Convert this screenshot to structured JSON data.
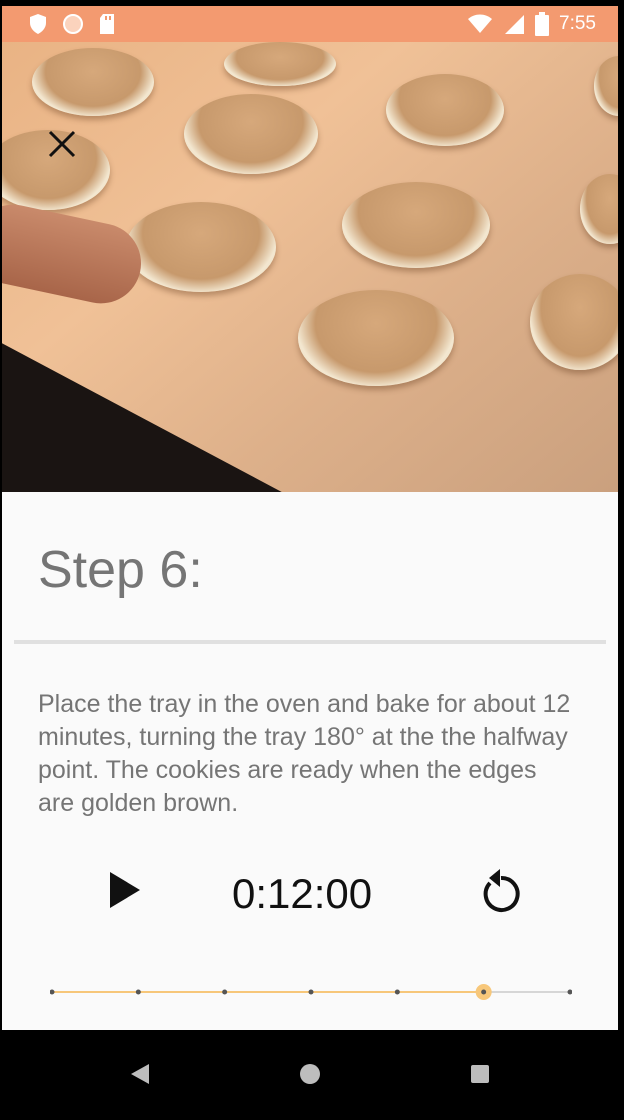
{
  "status_bar": {
    "time": "7:55",
    "icons": [
      "shield-icon",
      "circle-icon",
      "sd-card-icon",
      "wifi-icon",
      "signal-icon",
      "battery-icon"
    ]
  },
  "header": {
    "close_icon": "close-icon"
  },
  "step": {
    "title": "Step 6:",
    "description": "Place the tray in the oven and bake for about 12 minutes, turning the tray 180° at the the halfway point. The cookies are ready when the edges are golden brown."
  },
  "timer": {
    "display": "0:12:00",
    "play_icon": "play-icon",
    "replay_icon": "replay-icon"
  },
  "progress": {
    "total_steps": 7,
    "current_step": 6,
    "accent_color": "#f7c77a"
  },
  "nav": {
    "icons": [
      "back-icon",
      "home-icon",
      "recents-icon"
    ]
  },
  "colors": {
    "status_bar": "#f39a70",
    "text_secondary": "#757575"
  }
}
